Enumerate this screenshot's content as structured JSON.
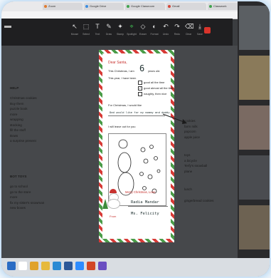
{
  "browser": {
    "tabs": [
      {
        "label": "Zoom",
        "color": "#e07b2f"
      },
      {
        "label": "Google Drive",
        "color": "#3c8de0"
      },
      {
        "label": "Google Classroom",
        "color": "#3fa34d"
      },
      {
        "label": "Gmail",
        "color": "#d44638"
      },
      {
        "label": "Classwork",
        "color": "#3fa34d"
      }
    ]
  },
  "toolbar": {
    "tools": [
      {
        "icon": "mouse-icon",
        "glyph": "↖",
        "label": "Mouse"
      },
      {
        "icon": "select-icon",
        "glyph": "⬚",
        "label": "Select"
      },
      {
        "icon": "text-icon",
        "glyph": "T",
        "label": "Text"
      },
      {
        "icon": "draw-icon",
        "glyph": "✎",
        "label": "Draw"
      },
      {
        "icon": "stamp-icon",
        "glyph": "✦",
        "label": "Stamp"
      },
      {
        "icon": "spotlight-icon",
        "glyph": "⌖",
        "label": "Spotlight"
      },
      {
        "icon": "eraser-icon",
        "glyph": "◇",
        "label": "Eraser"
      },
      {
        "icon": "format-icon",
        "glyph": "◐",
        "label": "Format"
      },
      {
        "icon": "undo-icon",
        "glyph": "↶",
        "label": "Undo"
      },
      {
        "icon": "redo-icon",
        "glyph": "↷",
        "label": "Redo"
      },
      {
        "icon": "clear-icon",
        "glyph": "⌫",
        "label": "Clear"
      },
      {
        "icon": "save-icon",
        "glyph": "⤓",
        "label": "Save"
      }
    ],
    "accent": "#3fb950",
    "close_color": "#d9342b"
  },
  "notes": {
    "help": "HELP",
    "help_list": "Christmas cookies\nBuy them\npuzzle book\nmore\nwrapping\nstocking\nfill the stuff\nBows\na surprise present",
    "toys_heading": "BOT TOYS",
    "toys_list": "go to school\ngo to the store\nmore\nfix my sister's snowman\nnew boxes",
    "right_list": "cookies\nfarm milk\npopcorn\napple juice",
    "right_list2": "toys\na bicycle\nTerfy's snowball\nplane",
    "right_list3": "lunch",
    "right_list4": "gingerbread cookies"
  },
  "letter": {
    "greeting": "Dear Santa,",
    "line1": "This Christmas, I am",
    "age": "6",
    "line1b": "years old.",
    "line2": "This year, I have been",
    "options": [
      "good all the time",
      "good almost all the time",
      "naughty, then nice"
    ],
    "checked_index": 1,
    "line3": "For Christmas, I would like",
    "answer_reply": "Dad would like for my mommy and daddy",
    "line4": "I will leave out for you",
    "sign_off": "Merry Christmas, Love,",
    "name": "Radia Mandar",
    "from_label": "From",
    "from_name": "Ms. Felicity"
  },
  "gallery": {
    "participants": [
      {
        "name": "",
        "color": "#5b5f63"
      },
      {
        "name": "",
        "color": "#8a7a5a"
      },
      {
        "name": "",
        "color": "#7a6a62"
      },
      {
        "name": "",
        "color": "#4a4c50"
      },
      {
        "name": "",
        "color": "#6d6252"
      }
    ]
  },
  "taskbar": {
    "apps": [
      {
        "icon": "windows-icon",
        "color": "#2b6cc4"
      },
      {
        "icon": "search-icon",
        "color": "#ffffff"
      },
      {
        "icon": "chrome-icon",
        "color": "#e0a22a"
      },
      {
        "icon": "explorer-icon",
        "color": "#e6b93c"
      },
      {
        "icon": "edge-icon",
        "color": "#2a8ad4"
      },
      {
        "icon": "word-icon",
        "color": "#2b5797"
      },
      {
        "icon": "zoom-icon",
        "color": "#2d8cff"
      },
      {
        "icon": "powerpoint-icon",
        "color": "#d24726"
      },
      {
        "icon": "photos-icon",
        "color": "#6a4ec1"
      }
    ]
  }
}
